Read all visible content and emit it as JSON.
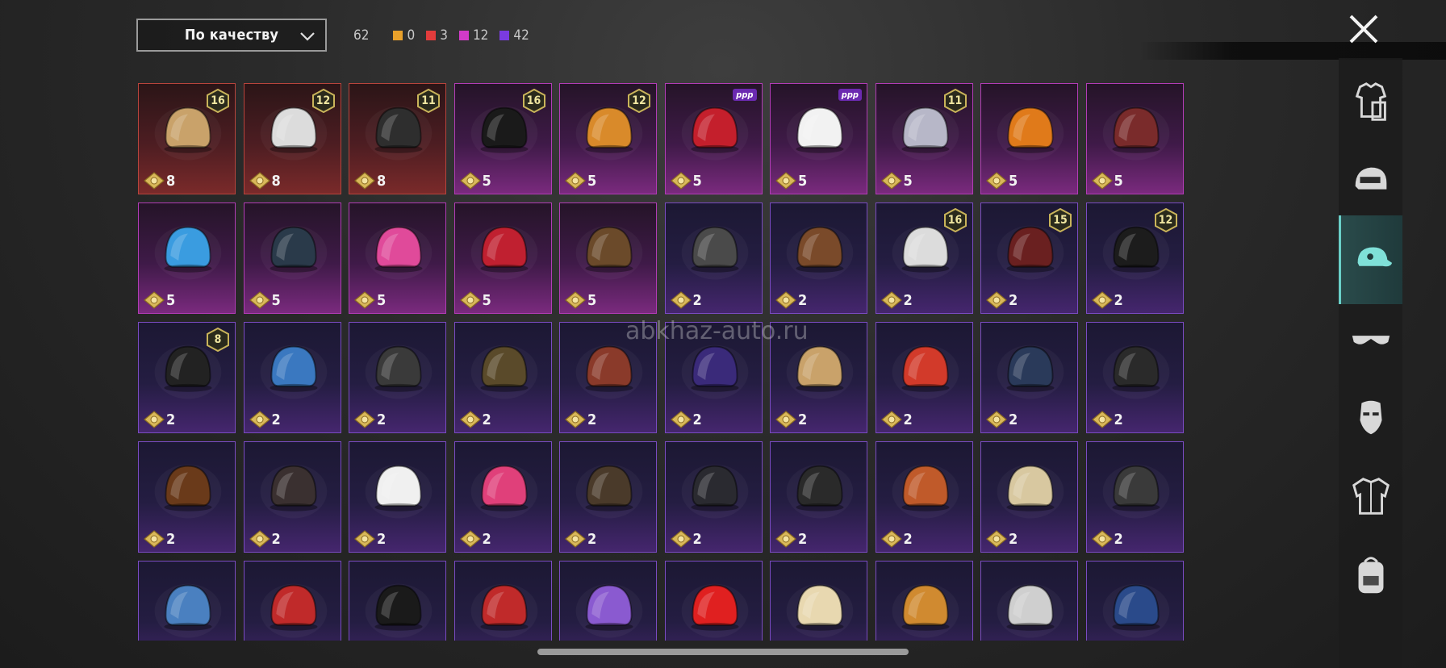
{
  "sort": {
    "label": "По качеству"
  },
  "counts": {
    "total": "62",
    "by_quality": [
      {
        "value": "0",
        "color": "#e9a12b"
      },
      {
        "value": "3",
        "color": "#e23c3c"
      },
      {
        "value": "12",
        "color": "#d13bc8"
      },
      {
        "value": "42",
        "color": "#7a3be0"
      }
    ]
  },
  "watermark": "abkhaz-auto.ru",
  "colors": {
    "red": "#b8443c",
    "pink": "#b23cb6",
    "purple": "#7a4bc2",
    "accent": "#6ad0c8"
  },
  "items": [
    {
      "cost": "8",
      "badge": "16",
      "quality": "red",
      "icon": "cat-ear-helmet-icon"
    },
    {
      "cost": "8",
      "badge": "12",
      "quality": "red",
      "icon": "white-hair-icon"
    },
    {
      "cost": "8",
      "badge": "11",
      "quality": "red",
      "icon": "black-hair-icon"
    },
    {
      "cost": "5",
      "badge": "16",
      "quality": "pink",
      "icon": "black-helmet-hair-icon"
    },
    {
      "cost": "5",
      "badge": "12",
      "quality": "pink",
      "icon": "orange-hair-icon"
    },
    {
      "cost": "5",
      "badge": "ppp",
      "quality": "pink",
      "icon": "red-hair-icon"
    },
    {
      "cost": "5",
      "badge": "ppp",
      "quality": "pink",
      "icon": "panda-mask-icon"
    },
    {
      "cost": "5",
      "badge": "11",
      "quality": "pink",
      "icon": "silver-hair-headband-icon"
    },
    {
      "cost": "5",
      "badge": "",
      "quality": "pink",
      "icon": "pumpkin-icon"
    },
    {
      "cost": "5",
      "badge": "",
      "quality": "pink",
      "icon": "bat-mask-icon"
    },
    {
      "cost": "5",
      "badge": "",
      "quality": "pink",
      "icon": "bear-cap-icon"
    },
    {
      "cost": "5",
      "badge": "",
      "quality": "pink",
      "icon": "neon-horns-icon"
    },
    {
      "cost": "5",
      "badge": "",
      "quality": "pink",
      "icon": "pink-bunny-hat-icon"
    },
    {
      "cost": "5",
      "badge": "",
      "quality": "pink",
      "icon": "red-horns-icon"
    },
    {
      "cost": "5",
      "badge": "",
      "quality": "pink",
      "icon": "bear-head-icon"
    },
    {
      "cost": "2",
      "badge": "",
      "quality": "purple",
      "icon": "goggles-helmets-icon"
    },
    {
      "cost": "2",
      "badge": "",
      "quality": "purple",
      "icon": "long-brown-hair-icon"
    },
    {
      "cost": "2",
      "badge": "16",
      "quality": "purple",
      "icon": "winter-hat-goggles-icon"
    },
    {
      "cost": "2",
      "badge": "15",
      "quality": "purple",
      "icon": "pumpkin-beanie-icon"
    },
    {
      "cost": "2",
      "badge": "12",
      "quality": "purple",
      "icon": "bunny-helmet-icon"
    },
    {
      "cost": "2",
      "badge": "8",
      "quality": "purple",
      "icon": "skull-mask-hair-icon"
    },
    {
      "cost": "2",
      "badge": "",
      "quality": "purple",
      "icon": "baseball-cap-icon"
    },
    {
      "cost": "2",
      "badge": "",
      "quality": "purple",
      "icon": "gas-mask-helmet-icon"
    },
    {
      "cost": "2",
      "badge": "",
      "quality": "purple",
      "icon": "tactical-helmet-icon"
    },
    {
      "cost": "2",
      "badge": "",
      "quality": "purple",
      "icon": "goggles-hair-icon"
    },
    {
      "cost": "2",
      "badge": "",
      "quality": "purple",
      "icon": "aviator-hat-icon"
    },
    {
      "cost": "2",
      "badge": "",
      "quality": "purple",
      "icon": "blonde-horn-hair-icon"
    },
    {
      "cost": "2",
      "badge": "",
      "quality": "purple",
      "icon": "fox-ears-icon"
    },
    {
      "cost": "2",
      "badge": "",
      "quality": "purple",
      "icon": "navy-beanie-icon"
    },
    {
      "cost": "2",
      "badge": "",
      "quality": "purple",
      "icon": "bucket-hat-red-hair-icon"
    },
    {
      "cost": "2",
      "badge": "",
      "quality": "purple",
      "icon": "brown-hair-icon"
    },
    {
      "cost": "2",
      "badge": "",
      "quality": "purple",
      "icon": "dark-hair-headband-icon"
    },
    {
      "cost": "2",
      "badge": "",
      "quality": "purple",
      "icon": "kabuki-mask-icon"
    },
    {
      "cost": "2",
      "badge": "",
      "quality": "purple",
      "icon": "pink-beret-icon"
    },
    {
      "cost": "2",
      "badge": "",
      "quality": "purple",
      "icon": "pilot-cap-icon"
    },
    {
      "cost": "2",
      "badge": "",
      "quality": "purple",
      "icon": "black-cap-icon"
    },
    {
      "cost": "2",
      "badge": "",
      "quality": "purple",
      "icon": "black-beanie-icon"
    },
    {
      "cost": "2",
      "badge": "",
      "quality": "purple",
      "icon": "football-helmet-icon"
    },
    {
      "cost": "2",
      "badge": "",
      "quality": "purple",
      "icon": "straw-hat-icon"
    },
    {
      "cost": "2",
      "badge": "",
      "quality": "purple",
      "icon": "wrestler-mask-icon"
    },
    {
      "cost": "",
      "badge": "",
      "quality": "purple",
      "icon": "shark-hat-icon"
    },
    {
      "cost": "",
      "badge": "",
      "quality": "purple",
      "icon": "red-beret-icon"
    },
    {
      "cost": "",
      "badge": "",
      "quality": "purple",
      "icon": "black-top-hat-icon"
    },
    {
      "cost": "",
      "badge": "",
      "quality": "purple",
      "icon": "red-fedora-icon"
    },
    {
      "cost": "",
      "badge": "",
      "quality": "purple",
      "icon": "flower-crown-icon"
    },
    {
      "cost": "",
      "badge": "",
      "quality": "purple",
      "icon": "red-bucket-hat-icon"
    },
    {
      "cost": "",
      "badge": "",
      "quality": "purple",
      "icon": "ice-cream-hat-icon"
    },
    {
      "cost": "",
      "badge": "",
      "quality": "purple",
      "icon": "burger-hat-icon"
    },
    {
      "cost": "",
      "badge": "",
      "quality": "purple",
      "icon": "head-mirror-icon"
    },
    {
      "cost": "",
      "badge": "",
      "quality": "purple",
      "icon": "sailor-cap-icon"
    }
  ],
  "sidebar": [
    {
      "icon": "outfit-icon",
      "active": false
    },
    {
      "icon": "helmet-icon",
      "active": false
    },
    {
      "icon": "cap-icon",
      "active": true
    },
    {
      "icon": "glasses-icon",
      "active": false
    },
    {
      "icon": "face-mask-icon",
      "active": false
    },
    {
      "icon": "jacket-icon",
      "active": false
    },
    {
      "icon": "backpack-icon",
      "active": false
    }
  ]
}
